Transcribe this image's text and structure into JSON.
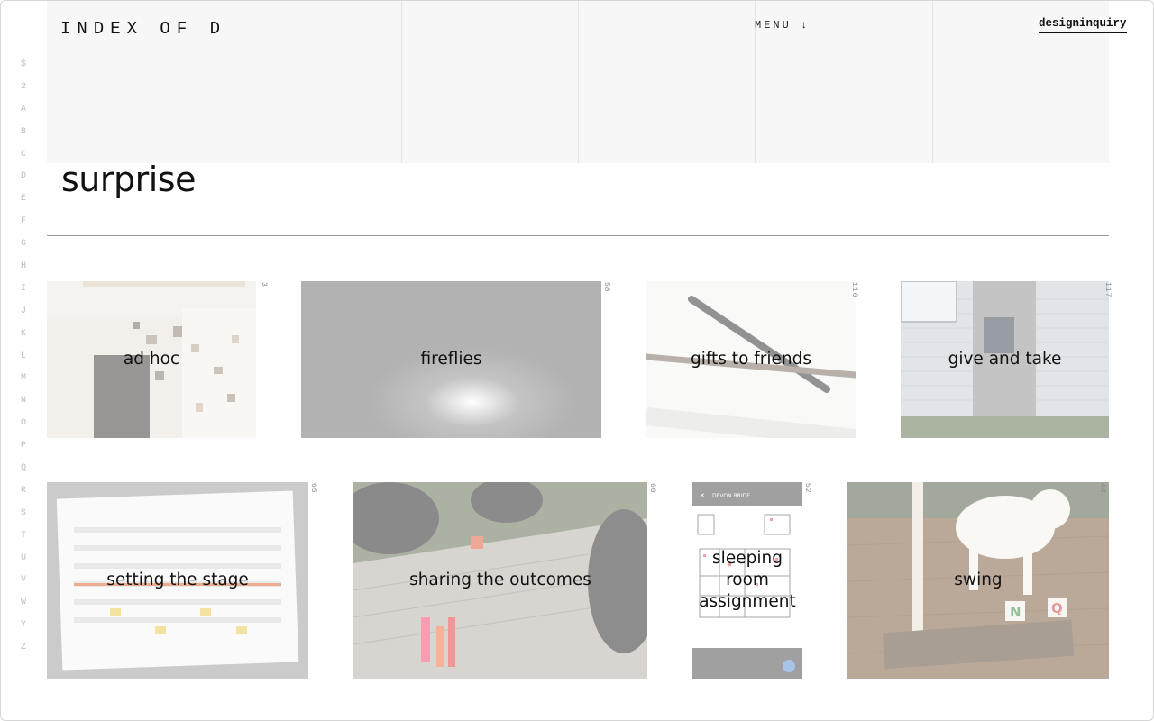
{
  "header": {
    "site_title": "INDEX OF DI",
    "menu_label": "MENU ↓",
    "brand_link": "designinquiry"
  },
  "alphabet_index": [
    "$",
    "2",
    "A",
    "B",
    "C",
    "D",
    "E",
    "F",
    "G",
    "H",
    "I",
    "J",
    "K",
    "L",
    "M",
    "N",
    "O",
    "P",
    "Q",
    "R",
    "S",
    "T",
    "U",
    "V",
    "W",
    "Y",
    "Z"
  ],
  "page": {
    "title": "surprise"
  },
  "entries": [
    {
      "label": "ad hoc",
      "number": "3"
    },
    {
      "label": "fireflies",
      "number": "58"
    },
    {
      "label": "gifts to friends",
      "number": "116"
    },
    {
      "label": "give and take",
      "number": "117"
    },
    {
      "label": "setting the stage",
      "number": "65"
    },
    {
      "label": "sharing the outcomes",
      "number": "60"
    },
    {
      "label": "sleeping room assignment",
      "number": "52"
    },
    {
      "label": "swing",
      "number": "44"
    }
  ],
  "phone_screenshot": {
    "header_text": "DEVON BRIDE"
  },
  "colors": {
    "header_band": "#f7f7f7",
    "alphabet": "#bdbdbd",
    "divider": "#9a9a9a"
  }
}
